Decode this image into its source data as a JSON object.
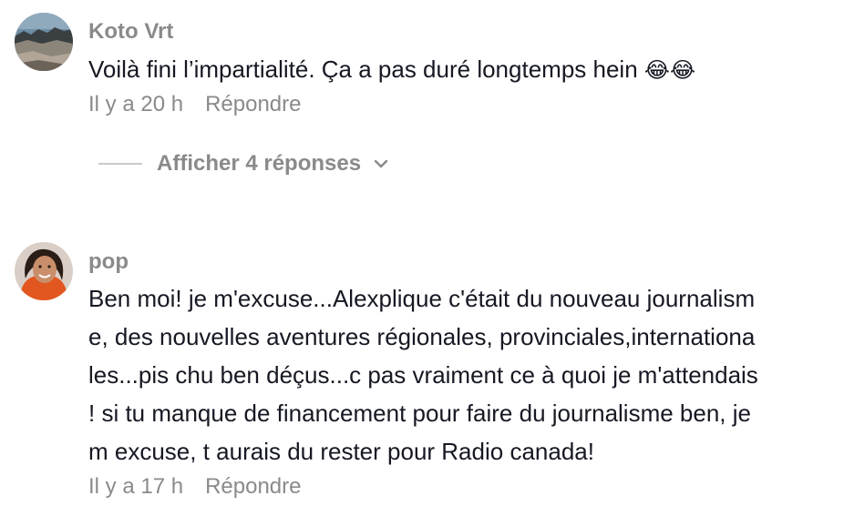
{
  "comments": [
    {
      "username": "Koto Vrt",
      "text_lines": [
        "Voilà fini l’impartialité. Ça a pas duré longtemps hein"
      ],
      "emoji": "😂😂",
      "time": "Il y a 20 h",
      "reply_label": "Répondre",
      "avatar_icon": "landscape-photo-avatar"
    },
    {
      "username": "pop",
      "text_lines": [
        "Ben moi! je m'excuse...Alexplique c'était du nouveau journalism",
        "e, des nouvelles aventures régionales, provinciales,internationa",
        "les...pis chu ben déçus...c pas vraiment ce à quoi je m'attendais",
        "! si tu manque de financement pour faire du journalisme ben, je",
        "m excuse, t aurais du rester pour Radio canada!"
      ],
      "time": "Il y a 17 h",
      "reply_label": "Répondre",
      "avatar_icon": "person-photo-avatar"
    }
  ],
  "replies_toggle": {
    "label": "Afficher 4 réponses",
    "icon": "chevron-down-icon"
  },
  "colors": {
    "text_primary": "#161823",
    "text_secondary": "#8a8a8a",
    "background": "#ffffff"
  }
}
